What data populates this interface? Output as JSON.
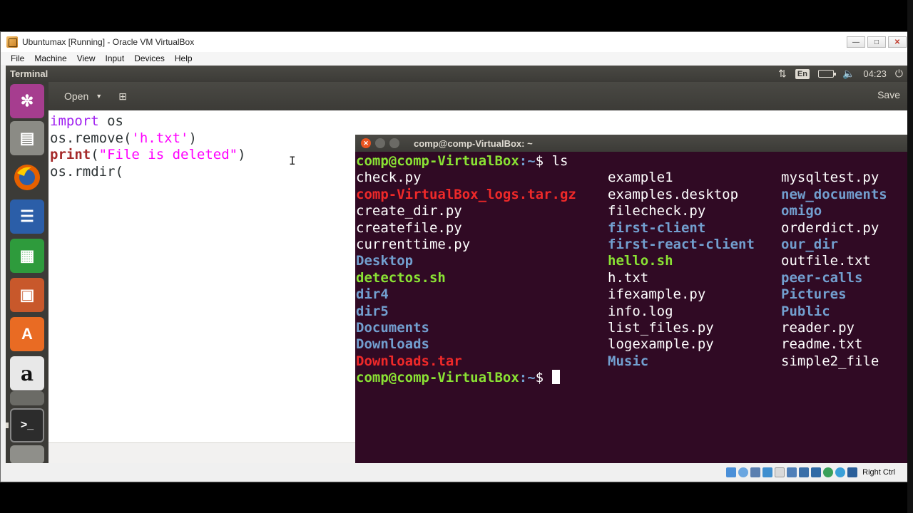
{
  "vbox": {
    "title": "Ubuntumax [Running] - Oracle VM VirtualBox",
    "menu": [
      "File",
      "Machine",
      "View",
      "Input",
      "Devices",
      "Help"
    ],
    "host_key": "Right Ctrl"
  },
  "topbar": {
    "app_title": "Terminal",
    "keyboard": "En",
    "time": "04:23"
  },
  "editor": {
    "open_label": "Open",
    "save_label": "Save",
    "lines": [
      {
        "parts": [
          {
            "t": "import",
            "c": "kw"
          },
          {
            "t": " os",
            "c": ""
          }
        ]
      },
      {
        "parts": [
          {
            "t": "os.remove(",
            "c": ""
          },
          {
            "t": "'h.txt'",
            "c": "str"
          },
          {
            "t": ")",
            "c": ""
          }
        ]
      },
      {
        "parts": [
          {
            "t": "print",
            "c": "kw2"
          },
          {
            "t": "(",
            "c": ""
          },
          {
            "t": "\"File is deleted\"",
            "c": "str"
          },
          {
            "t": ")",
            "c": ""
          }
        ]
      },
      {
        "parts": [
          {
            "t": "os.rmdir(",
            "c": ""
          }
        ]
      }
    ]
  },
  "terminal": {
    "title": "comp@comp-VirtualBox: ~",
    "prompt_user": "comp@comp-VirtualBox",
    "prompt_path": ":~",
    "prompt_sign": "$ ",
    "command": "ls",
    "listing_rows": [
      [
        {
          "n": "check.py",
          "k": "file"
        },
        {
          "n": "example1",
          "k": "file"
        },
        {
          "n": "mysqltest.py",
          "k": "file"
        }
      ],
      [
        {
          "n": "comp-VirtualBox_logs.tar.gz",
          "k": "arch"
        },
        {
          "n": "examples.desktop",
          "k": "file"
        },
        {
          "n": "new_documents",
          "k": "dir"
        }
      ],
      [
        {
          "n": "create_dir.py",
          "k": "file"
        },
        {
          "n": "filecheck.py",
          "k": "file"
        },
        {
          "n": "omigo",
          "k": "dir"
        }
      ],
      [
        {
          "n": "createfile.py",
          "k": "file"
        },
        {
          "n": "first-client",
          "k": "dir"
        },
        {
          "n": "orderdict.py",
          "k": "file"
        }
      ],
      [
        {
          "n": "currenttime.py",
          "k": "file"
        },
        {
          "n": "first-react-client",
          "k": "dir"
        },
        {
          "n": "our_dir",
          "k": "dir"
        }
      ],
      [
        {
          "n": "Desktop",
          "k": "dir"
        },
        {
          "n": "hello.sh",
          "k": "exec"
        },
        {
          "n": "outfile.txt",
          "k": "file"
        }
      ],
      [
        {
          "n": "detectos.sh",
          "k": "exec"
        },
        {
          "n": "h.txt",
          "k": "file"
        },
        {
          "n": "peer-calls",
          "k": "dir"
        }
      ],
      [
        {
          "n": "dir4",
          "k": "dir"
        },
        {
          "n": "ifexample.py",
          "k": "file"
        },
        {
          "n": "Pictures",
          "k": "dir"
        }
      ],
      [
        {
          "n": "dir5",
          "k": "dir"
        },
        {
          "n": "info.log",
          "k": "file"
        },
        {
          "n": "Public",
          "k": "dir"
        }
      ],
      [
        {
          "n": "Documents",
          "k": "dir"
        },
        {
          "n": "list_files.py",
          "k": "file"
        },
        {
          "n": "reader.py",
          "k": "file"
        }
      ],
      [
        {
          "n": "Downloads",
          "k": "dir"
        },
        {
          "n": "logexample.py",
          "k": "file"
        },
        {
          "n": "readme.txt",
          "k": "file"
        }
      ],
      [
        {
          "n": "Downloads.tar",
          "k": "arch"
        },
        {
          "n": "Music",
          "k": "dir"
        },
        {
          "n": "simple2_file",
          "k": "file"
        }
      ]
    ]
  },
  "launcher": [
    "ubuntu-dash-icon",
    "files-icon",
    "firefox-icon",
    "writer-icon",
    "calc-icon",
    "impress-icon",
    "software-center-icon",
    "amazon-icon",
    "settings-icon",
    "terminal-icon",
    "other-app-icon"
  ],
  "colors": {
    "terminal_bg": "#300a24",
    "prompt_green": "#8ae234",
    "dir_blue": "#729fcf",
    "archive_red": "#ef2929",
    "launcher_bg": "#3c3b37"
  }
}
